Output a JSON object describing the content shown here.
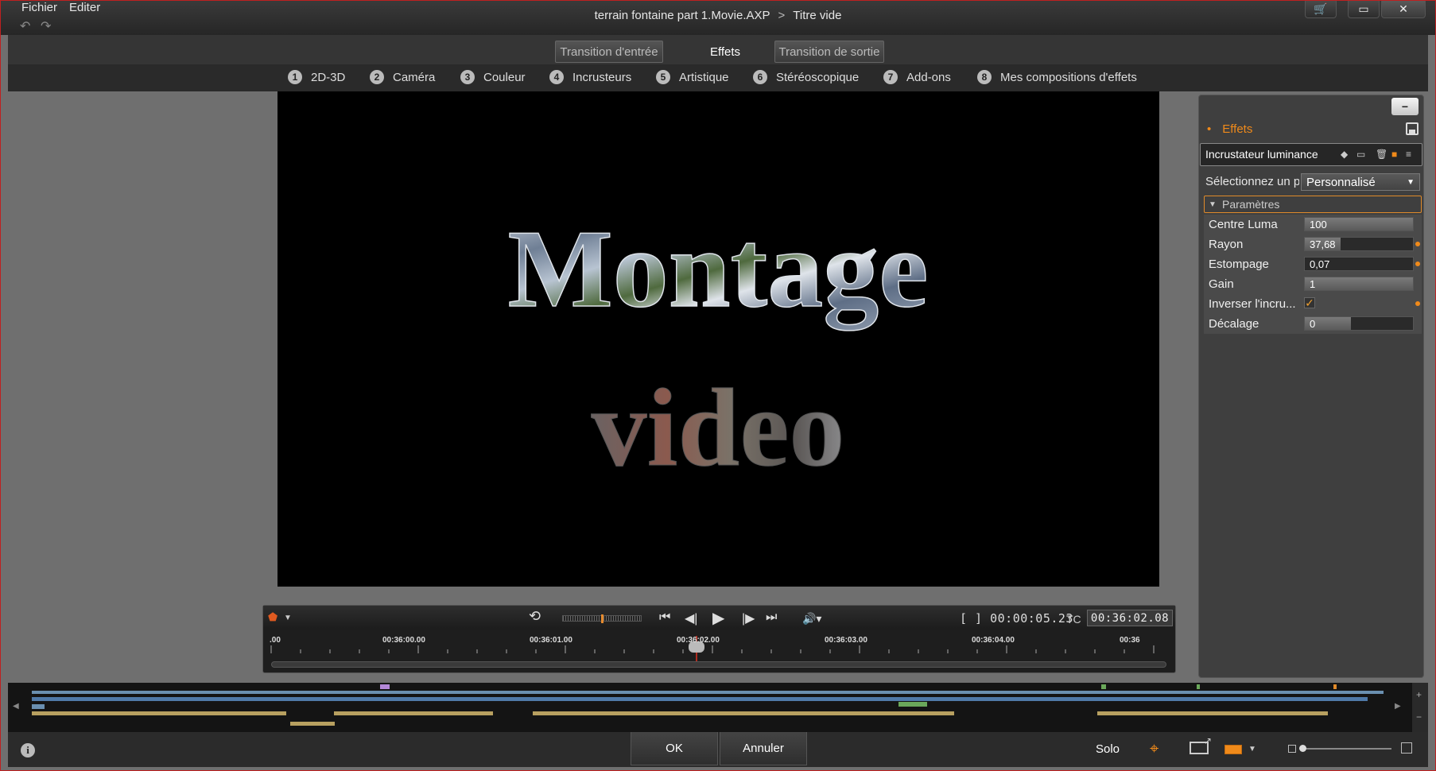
{
  "menu": {
    "file": "Fichier",
    "edit": "Editer"
  },
  "title": {
    "project": "terrain fontaine part 1.Movie.AXP",
    "separator": ">",
    "item": "Titre vide"
  },
  "tabs": [
    {
      "label": "Transition d'entrée"
    },
    {
      "label": "Effets"
    },
    {
      "label": "Transition de sortie"
    }
  ],
  "categories": [
    {
      "num": "1",
      "label": "2D-3D"
    },
    {
      "num": "2",
      "label": "Caméra"
    },
    {
      "num": "3",
      "label": "Couleur"
    },
    {
      "num": "4",
      "label": "Incrusteurs"
    },
    {
      "num": "5",
      "label": "Artistique"
    },
    {
      "num": "6",
      "label": "Stéréoscopique"
    },
    {
      "num": "7",
      "label": "Add-ons"
    },
    {
      "num": "8",
      "label": "Mes compositions d'effets"
    }
  ],
  "preview": {
    "line1": "Montage",
    "line2": "video"
  },
  "transport": {
    "duration": "[ ] 00:00:05.23",
    "tc_label": "TC",
    "timecode": "00:36:02.08",
    "ruler": [
      ".00",
      "00:36:00.00",
      "00:36:01.00",
      "00:36:02.00",
      "00:36:03.00",
      "00:36:04.00",
      "00:36"
    ]
  },
  "fxpanel": {
    "collapse": "−",
    "header": "Effets",
    "effect_name": "Incrustateur luminance",
    "preset_label": "Sélectionnez un préréglage",
    "preset_value": "Personnalisé",
    "params_header": "Paramètres",
    "params": [
      {
        "label": "Centre Luma",
        "value": "100",
        "fill": 1.0,
        "keyframe": false
      },
      {
        "label": "Rayon",
        "value": "37,68",
        "fill": 0.33,
        "keyframe": true
      },
      {
        "label": "Estompage",
        "value": "0,07",
        "fill": 0.0,
        "keyframe": true
      },
      {
        "label": "Gain",
        "value": "1",
        "fill": 1.0,
        "keyframe": false
      },
      {
        "label": "Inverser l'incru...",
        "value": "",
        "checked": true,
        "keyframe": true
      },
      {
        "label": "Décalage",
        "value": "0",
        "fill": 0.43,
        "keyframe": false
      }
    ]
  },
  "footer": {
    "ok": "OK",
    "cancel": "Annuler",
    "solo": "Solo"
  },
  "icons": {
    "undo": "undo-icon",
    "redo": "redo-icon",
    "cart": "cart-icon",
    "maximize": "maximize-icon",
    "close": "close-icon",
    "play": "play-icon",
    "info": "info-icon",
    "target": "target-icon"
  },
  "colors": {
    "accent": "#f08a1a",
    "preview_bg": "#000000",
    "panel_bg": "#3f3f3f"
  }
}
